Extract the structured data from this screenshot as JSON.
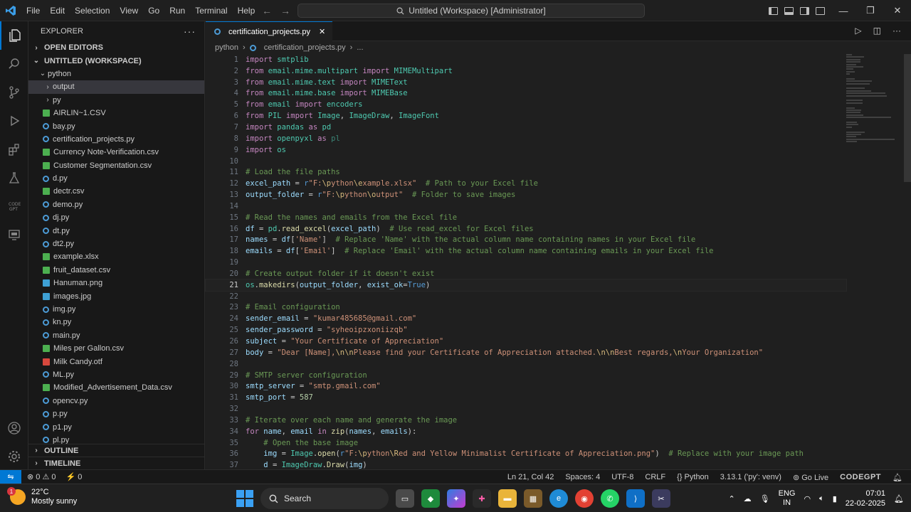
{
  "titlebar": {
    "menu": [
      "File",
      "Edit",
      "Selection",
      "View",
      "Go",
      "Run",
      "Terminal",
      "Help"
    ],
    "command_center": "Untitled (Workspace) [Administrator]"
  },
  "sidebar": {
    "title": "EXPLORER",
    "open_editors": "OPEN EDITORS",
    "workspace": "UNTITLED (WORKSPACE)",
    "root_folder": "python",
    "files": [
      {
        "name": "output",
        "type": "folder",
        "selected": true
      },
      {
        "name": "py",
        "type": "folder"
      },
      {
        "name": "AIRLIN~1.CSV",
        "type": "csv"
      },
      {
        "name": "bay.py",
        "type": "py"
      },
      {
        "name": "certification_projects.py",
        "type": "py"
      },
      {
        "name": "Currency Note-Verification.csv",
        "type": "csv"
      },
      {
        "name": "Customer Segmentation.csv",
        "type": "csv"
      },
      {
        "name": "d.py",
        "type": "py"
      },
      {
        "name": "dectr.csv",
        "type": "csv"
      },
      {
        "name": "demo.py",
        "type": "py"
      },
      {
        "name": "dj.py",
        "type": "py"
      },
      {
        "name": "dt.py",
        "type": "py"
      },
      {
        "name": "dt2.py",
        "type": "py"
      },
      {
        "name": "example.xlsx",
        "type": "xlsx"
      },
      {
        "name": "fruit_dataset.csv",
        "type": "csv"
      },
      {
        "name": "Hanuman.png",
        "type": "png"
      },
      {
        "name": "images.jpg",
        "type": "png"
      },
      {
        "name": "img.py",
        "type": "py"
      },
      {
        "name": "kn.py",
        "type": "py"
      },
      {
        "name": "main.py",
        "type": "py"
      },
      {
        "name": "Miles per Gallon.csv",
        "type": "csv"
      },
      {
        "name": "Milk Candy.otf",
        "type": "otf"
      },
      {
        "name": "ML.py",
        "type": "py"
      },
      {
        "name": "Modified_Advertisement_Data.csv",
        "type": "csv"
      },
      {
        "name": "opencv.py",
        "type": "py"
      },
      {
        "name": "p.py",
        "type": "py"
      },
      {
        "name": "p1.py",
        "type": "py"
      },
      {
        "name": "pl.py",
        "type": "py"
      }
    ],
    "outline": "OUTLINE",
    "timeline": "TIMELINE"
  },
  "editor": {
    "tab_label": "certification_projects.py",
    "breadcrumb": [
      "python",
      "certification_projects.py",
      "..."
    ],
    "current_line": 21,
    "lines": [
      {
        "n": "1",
        "h": "<span class='k'>import</span> <span class='t'>smtplib</span>"
      },
      {
        "n": "2",
        "h": "<span class='k'>from</span> <span class='t'>email.mime.multipart</span> <span class='k'>import</span> <span class='t'>MIMEMultipart</span>"
      },
      {
        "n": "3",
        "h": "<span class='k'>from</span> <span class='t'>email.mime.text</span> <span class='k'>import</span> <span class='t'>MIMEText</span>"
      },
      {
        "n": "4",
        "h": "<span class='k'>from</span> <span class='t'>email.mime.base</span> <span class='k'>import</span> <span class='t'>MIMEBase</span>"
      },
      {
        "n": "5",
        "h": "<span class='k'>from</span> <span class='t'>email</span> <span class='k'>import</span> <span class='t'>encoders</span>"
      },
      {
        "n": "6",
        "h": "<span class='k'>from</span> <span class='t'>PIL</span> <span class='k'>import</span> <span class='t'>Image</span>, <span class='t'>ImageDraw</span>, <span class='t'>ImageFont</span>"
      },
      {
        "n": "7",
        "h": "<span class='k'>import</span> <span class='t'>pandas</span> <span class='k'>as</span> <span class='t'>pd</span>"
      },
      {
        "n": "8",
        "h": "<span class='k'>import</span> <span class='t'>openpyxl</span> <span class='k'>as</span> <span class='t' style='opacity:.6'>pl</span>"
      },
      {
        "n": "9",
        "h": "<span class='k'>import</span> <span class='t'>os</span>"
      },
      {
        "n": "10",
        "h": ""
      },
      {
        "n": "11",
        "h": "<span class='c'># Load the file paths</span>"
      },
      {
        "n": "12",
        "h": "<span class='n'>excel_path</span> = <span class='b'>r</span><span class='s'>\"F:</span><span class='e'>\\p</span><span class='s'>ython</span><span class='e'>\\e</span><span class='s'>xample.xlsx\"</span>  <span class='c'># Path to your Excel file</span>"
      },
      {
        "n": "13",
        "h": "<span class='n'>output_folder</span> = <span class='b'>r</span><span class='s'>\"F:</span><span class='e'>\\p</span><span class='s'>ython</span><span class='e'>\\o</span><span class='s'>utput\"</span>  <span class='c'># Folder to save images</span>"
      },
      {
        "n": "14",
        "h": ""
      },
      {
        "n": "15",
        "h": "<span class='c'># Read the names and emails from the Excel file</span>"
      },
      {
        "n": "16",
        "h": "<span class='n'>df</span> = <span class='t'>pd</span>.<span class='f'>read_excel</span>(<span class='n'>excel_path</span>)  <span class='c'># Use read_excel for Excel files</span>"
      },
      {
        "n": "17",
        "h": "<span class='n'>names</span> = <span class='n'>df</span>[<span class='s'>'Name'</span>]  <span class='c'># Replace 'Name' with the actual column name containing names in your Excel file</span>"
      },
      {
        "n": "18",
        "h": "<span class='n'>emails</span> = <span class='n'>df</span>[<span class='s'>'Email'</span>]  <span class='c'># Replace 'Email' with the actual column name containing emails in your Excel file</span>"
      },
      {
        "n": "19",
        "h": ""
      },
      {
        "n": "20",
        "h": "<span class='c'># Create output folder if it doesn't exist</span>"
      },
      {
        "n": "21",
        "h": "<span class='t'>os</span>.<span class='f'>makedirs</span>(<span class='n'>output_folder</span>, <span class='n'>exist_ok</span>=<span class='b'>True</span>)"
      },
      {
        "n": "22",
        "h": ""
      },
      {
        "n": "23",
        "h": "<span class='c'># Email configuration</span>"
      },
      {
        "n": "24",
        "h": "<span class='n'>sender_email</span> = <span class='s'>\"kumar485685@gmail.com\"</span>"
      },
      {
        "n": "25",
        "h": "<span class='n'>sender_password</span> = <span class='s'>\"syheoipzxoniizqb\"</span>"
      },
      {
        "n": "26",
        "h": "<span class='n'>subject</span> = <span class='s'>\"Your Certificate of Appreciation\"</span>"
      },
      {
        "n": "27",
        "h": "<span class='n'>body</span> = <span class='s'>\"Dear [Name],</span><span class='e'>\\n\\n</span><span class='s'>Please find your Certificate of Appreciation attached.</span><span class='e'>\\n\\n</span><span class='s'>Best regards,</span><span class='e'>\\n</span><span class='s'>Your Organization\"</span>"
      },
      {
        "n": "28",
        "h": ""
      },
      {
        "n": "29",
        "h": "<span class='c'># SMTP server configuration</span>"
      },
      {
        "n": "30",
        "h": "<span class='n'>smtp_server</span> = <span class='s'>\"smtp.gmail.com\"</span>"
      },
      {
        "n": "31",
        "h": "<span class='n'>smtp_port</span> = <span class='m'>587</span>"
      },
      {
        "n": "32",
        "h": ""
      },
      {
        "n": "33",
        "h": "<span class='c'># Iterate over each name and generate the image</span>"
      },
      {
        "n": "34",
        "h": "<span class='k'>for</span> <span class='n'>name</span>, <span class='n'>email</span> <span class='k'>in</span> <span class='f'>zip</span>(<span class='n'>names</span>, <span class='n'>emails</span>):"
      },
      {
        "n": "35",
        "h": "    <span class='c'># Open the base image</span>"
      },
      {
        "n": "36",
        "h": "    <span class='n'>img</span> = <span class='t'>Image</span>.<span class='f'>open</span>(<span class='b'>r</span><span class='s'>\"F:</span><span class='e'>\\p</span><span class='s'>ython</span><span class='e'>\\R</span><span class='s'>ed and Yellow Minimalist Certificate of Appreciation.png\"</span>)  <span class='c'># Replace with your image path</span>"
      },
      {
        "n": "37",
        "h": "    <span class='n'>d</span> = <span class='t'>ImageDraw</span>.<span class='f'>Draw</span>(<span class='n'>img</span>)"
      }
    ]
  },
  "statusbar": {
    "problems": "⊗ 0 ⚠ 0",
    "ports": "⚡ 0",
    "position": "Ln 21, Col 42",
    "spaces": "Spaces: 4",
    "encoding": "UTF-8",
    "eol": "CRLF",
    "language": "{} Python",
    "interpreter": "3.13.1 ('py': venv)",
    "golive": "⊚ Go Live",
    "codegpt": "CODEGPT"
  },
  "taskbar": {
    "temperature": "22°C",
    "weather": "Mostly sunny",
    "weather_badge": "1",
    "search_label": "Search",
    "lang_1": "ENG",
    "lang_2": "IN",
    "time": "07:01",
    "date": "22-02-2025"
  }
}
